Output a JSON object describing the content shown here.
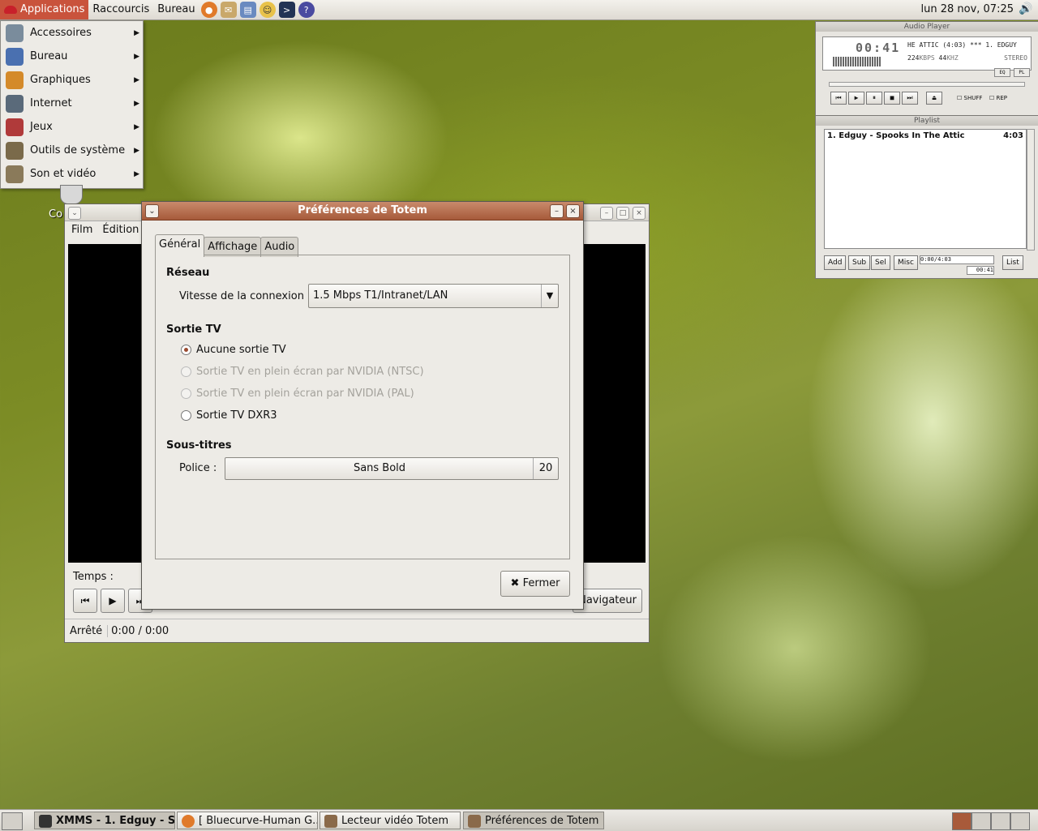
{
  "top_panel": {
    "menus": [
      "Applications",
      "Raccourcis",
      "Bureau"
    ],
    "launchers": [
      "firefox-icon",
      "mail-icon",
      "office-icon",
      "chat-icon",
      "terminal-icon",
      "help-icon"
    ],
    "clock": "lun 28 nov, 07:25"
  },
  "applications_menu": {
    "items": [
      {
        "label": "Accessoires",
        "icon": "accessories-icon",
        "color": "#7a8c9c"
      },
      {
        "label": "Bureau",
        "icon": "office-icon",
        "color": "#4a70b0"
      },
      {
        "label": "Graphiques",
        "icon": "graphics-icon",
        "color": "#d48a2a"
      },
      {
        "label": "Internet",
        "icon": "internet-icon",
        "color": "#5a6a7a"
      },
      {
        "label": "Jeux",
        "icon": "games-icon",
        "color": "#b03a3a"
      },
      {
        "label": "Outils de système",
        "icon": "system-tools-icon",
        "color": "#7a6a4a"
      },
      {
        "label": "Son et vidéo",
        "icon": "sound-video-icon",
        "color": "#8a7a5a"
      }
    ]
  },
  "desktop": {
    "icon_label": "Co"
  },
  "totem": {
    "menus": [
      "Film",
      "Édition"
    ],
    "temps_label": "Temps :",
    "navigator_label": "Navigateur",
    "status": "Arrêté",
    "time": "0:00 / 0:00"
  },
  "prefs": {
    "title": "Préférences de Totem",
    "tabs": [
      "Général",
      "Affichage",
      "Audio"
    ],
    "reseau_heading": "Réseau",
    "speed_label": "Vitesse de la connexion :",
    "speed_value": "1.5 Mbps T1/Intranet/LAN",
    "tv_heading": "Sortie TV",
    "tv_options": [
      {
        "label": "Aucune sortie TV",
        "selected": true,
        "disabled": false
      },
      {
        "label": "Sortie TV en plein écran par NVIDIA (NTSC)",
        "selected": false,
        "disabled": true
      },
      {
        "label": "Sortie TV en plein écran par NVIDIA (PAL)",
        "selected": false,
        "disabled": true
      },
      {
        "label": "Sortie TV DXR3",
        "selected": false,
        "disabled": false
      }
    ],
    "subtitles_heading": "Sous-titres",
    "font_label": "Police :",
    "font_name": "Sans Bold",
    "font_size": "20",
    "close_label": "Fermer"
  },
  "xmms": {
    "title": "Audio Player",
    "time": "00:41",
    "song": "HE ATTIC (4:03)  ***  1. EDGUY",
    "kbps": "224",
    "kbps_unit": "KBPS",
    "khz": "44",
    "khz_unit": "KHZ",
    "stereo": "STEREO",
    "eq": "EQ",
    "pl": "PL",
    "shuffle": "SHUFF",
    "repeat": "REP",
    "playlist_title": "Playlist",
    "track": "1. Edguy - Spooks In The Attic",
    "track_length": "4:03",
    "buttons": [
      "Add",
      "Sub",
      "Sel",
      "Misc"
    ],
    "list_button": "List",
    "pl_time": "0:00/4:03",
    "pl_elapsed": "00:41"
  },
  "taskbar": {
    "tasks": [
      {
        "label": "XMMS - 1. Edguy - S...",
        "active": true
      },
      {
        "label": "[ Bluecurve-Human G...",
        "active": false
      },
      {
        "label": "Lecteur vidéo Totem",
        "active": false
      },
      {
        "label": "Préférences de Totem",
        "active": true
      }
    ]
  }
}
